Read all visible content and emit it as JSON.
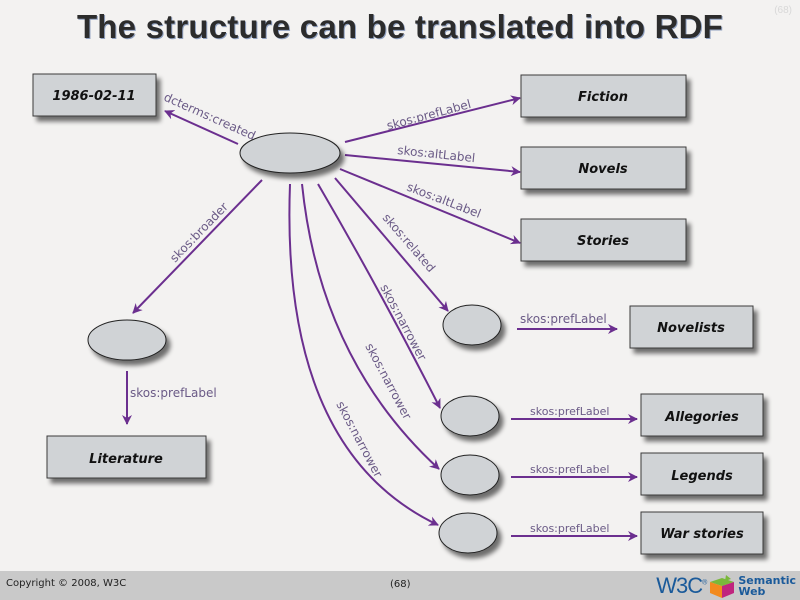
{
  "slide": {
    "title": "The structure can be translated into RDF",
    "corner_page": "(68)",
    "footer": {
      "copyright": "Copyright © 2008, W3C",
      "page": "(68)",
      "logo_w3c": "W3C",
      "logo_reg": "®",
      "logo_line1": "Semantic",
      "logo_line2": "Web"
    }
  },
  "colors": {
    "edge": "#6b2f8f",
    "node_fill": "#d0d3d6",
    "background": "#f3f2f1",
    "footer": "#c9c9c9"
  },
  "diagram": {
    "literals": {
      "date": "1986-02-11",
      "fiction": "Fiction",
      "novels": "Novels",
      "stories": "Stories",
      "novelists": "Novelists",
      "literature": "Literature",
      "allegories": "Allegories",
      "legends": "Legends",
      "war_stories": "War stories"
    },
    "edges": {
      "created": "dcterms:created",
      "pref": "skos:prefLabel",
      "alt1": "skos:altLabel",
      "alt2": "skos:altLabel",
      "related": "skos:related",
      "broader": "skos:broader",
      "narrower1": "skos:narrower",
      "narrower2": "skos:narrower",
      "narrower3": "skos:narrower",
      "lit_pref": "skos:prefLabel",
      "novelists_pref": "skos:prefLabel",
      "allegories_pref": "skos:prefLabel",
      "legends_pref": "skos:prefLabel",
      "war_pref": "skos:prefLabel"
    }
  }
}
